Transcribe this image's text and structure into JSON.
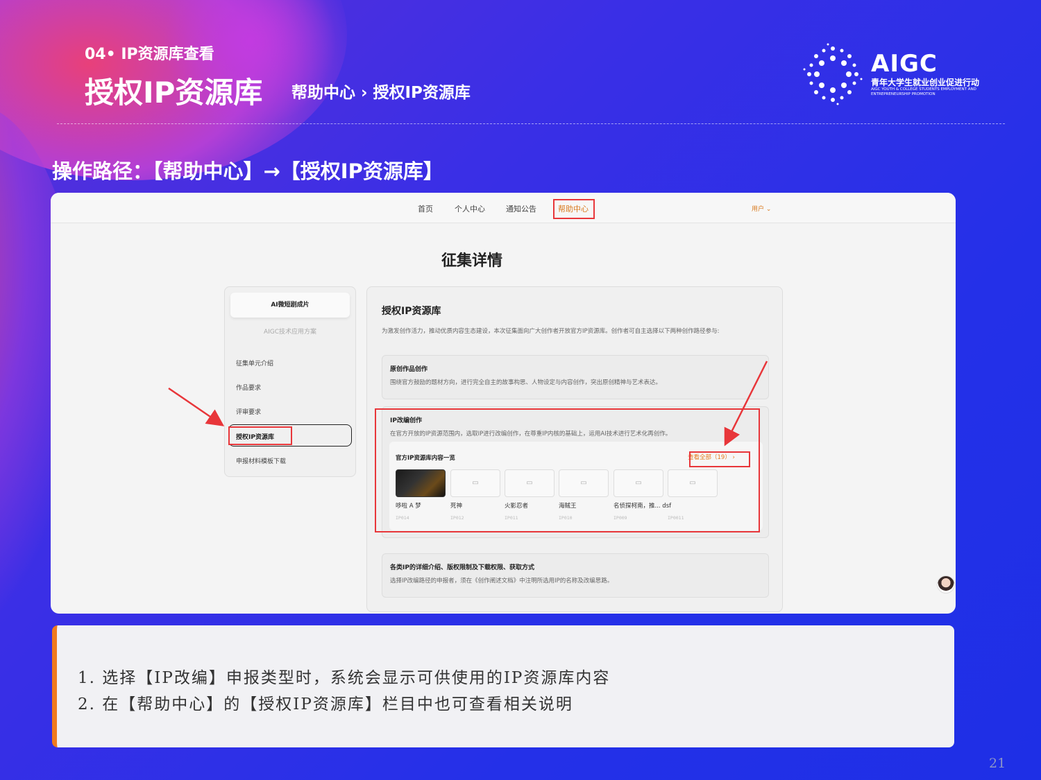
{
  "header": {
    "section": "04• IP资源库查看",
    "title": "授权IP资源库",
    "breadcrumb": "帮助中心 › 授权IP资源库",
    "logo_main": "AIGC",
    "logo_sub": "青年大学生就业创业促进行动",
    "logo_tiny": "AIGC YOUTH & COLLEGE STUDENTS EMPLOYMENT AND ENTREPRENEURSHIP PROMOTION"
  },
  "path_label": "操作路径：【帮助中心】→【授权IP资源库】",
  "screenshot": {
    "nav": [
      "首页",
      "个人中心",
      "通知公告",
      "帮助中心"
    ],
    "user": "用户 ⌄",
    "page_heading": "征集详情",
    "sidebar": {
      "card": "AI微短剧成片",
      "subtitle": "AIGC技术应用方案",
      "items": [
        "征集单元介绍",
        "作品要求",
        "评审要求",
        "授权IP资源库",
        "申报材料模板下载"
      ]
    },
    "main": {
      "heading": "授权IP资源库",
      "desc": "为激发创作活力，推动优质内容生态建设，本次征集面向广大创作者开放官方IP资源库。创作者可自主选择以下两种创作路径参与:",
      "box1_title": "原创作品创作",
      "box1_desc": "围绕官方鼓励的题材方向，进行完全自主的故事构思、人物设定与内容创作，突出原创精神与艺术表达。",
      "box2_title": "IP改编创作",
      "box2_desc": "在官方开放的IP资源范围内，选取IP进行改编创作，在尊重IP内核的基础上，运用AI技术进行艺术化再创作。",
      "inner_title": "官方IP资源库内容一览",
      "view_all": "查看全部（19） ›",
      "tiles": [
        {
          "name": "哆啦 A 梦",
          "code": "IP014"
        },
        {
          "name": "死神",
          "code": "IP012"
        },
        {
          "name": "火影忍者",
          "code": "IP011"
        },
        {
          "name": "海贼王",
          "code": "IP010"
        },
        {
          "name": "名侦探柯南，推... dsf",
          "code": "IP009"
        },
        {
          "name": "",
          "code": "IP0011"
        }
      ],
      "box3_title": "各类IP的详细介绍、版权限制及下载权限、获取方式",
      "box3_desc": "选择IP改编路径的申报者，须在《创作阐述文档》中注明所选用IP的名称及改编思路。"
    }
  },
  "notes": [
    "1. 选择【IP改编】申报类型时，系统会显示可供使用的IP资源库内容",
    "2. 在【帮助中心】的【授权IP资源库】栏目中也可查看相关说明"
  ],
  "page_number": "21",
  "colors": {
    "background": "#2430e8",
    "accent": "#f07a1e",
    "highlight": "#e8363a"
  }
}
